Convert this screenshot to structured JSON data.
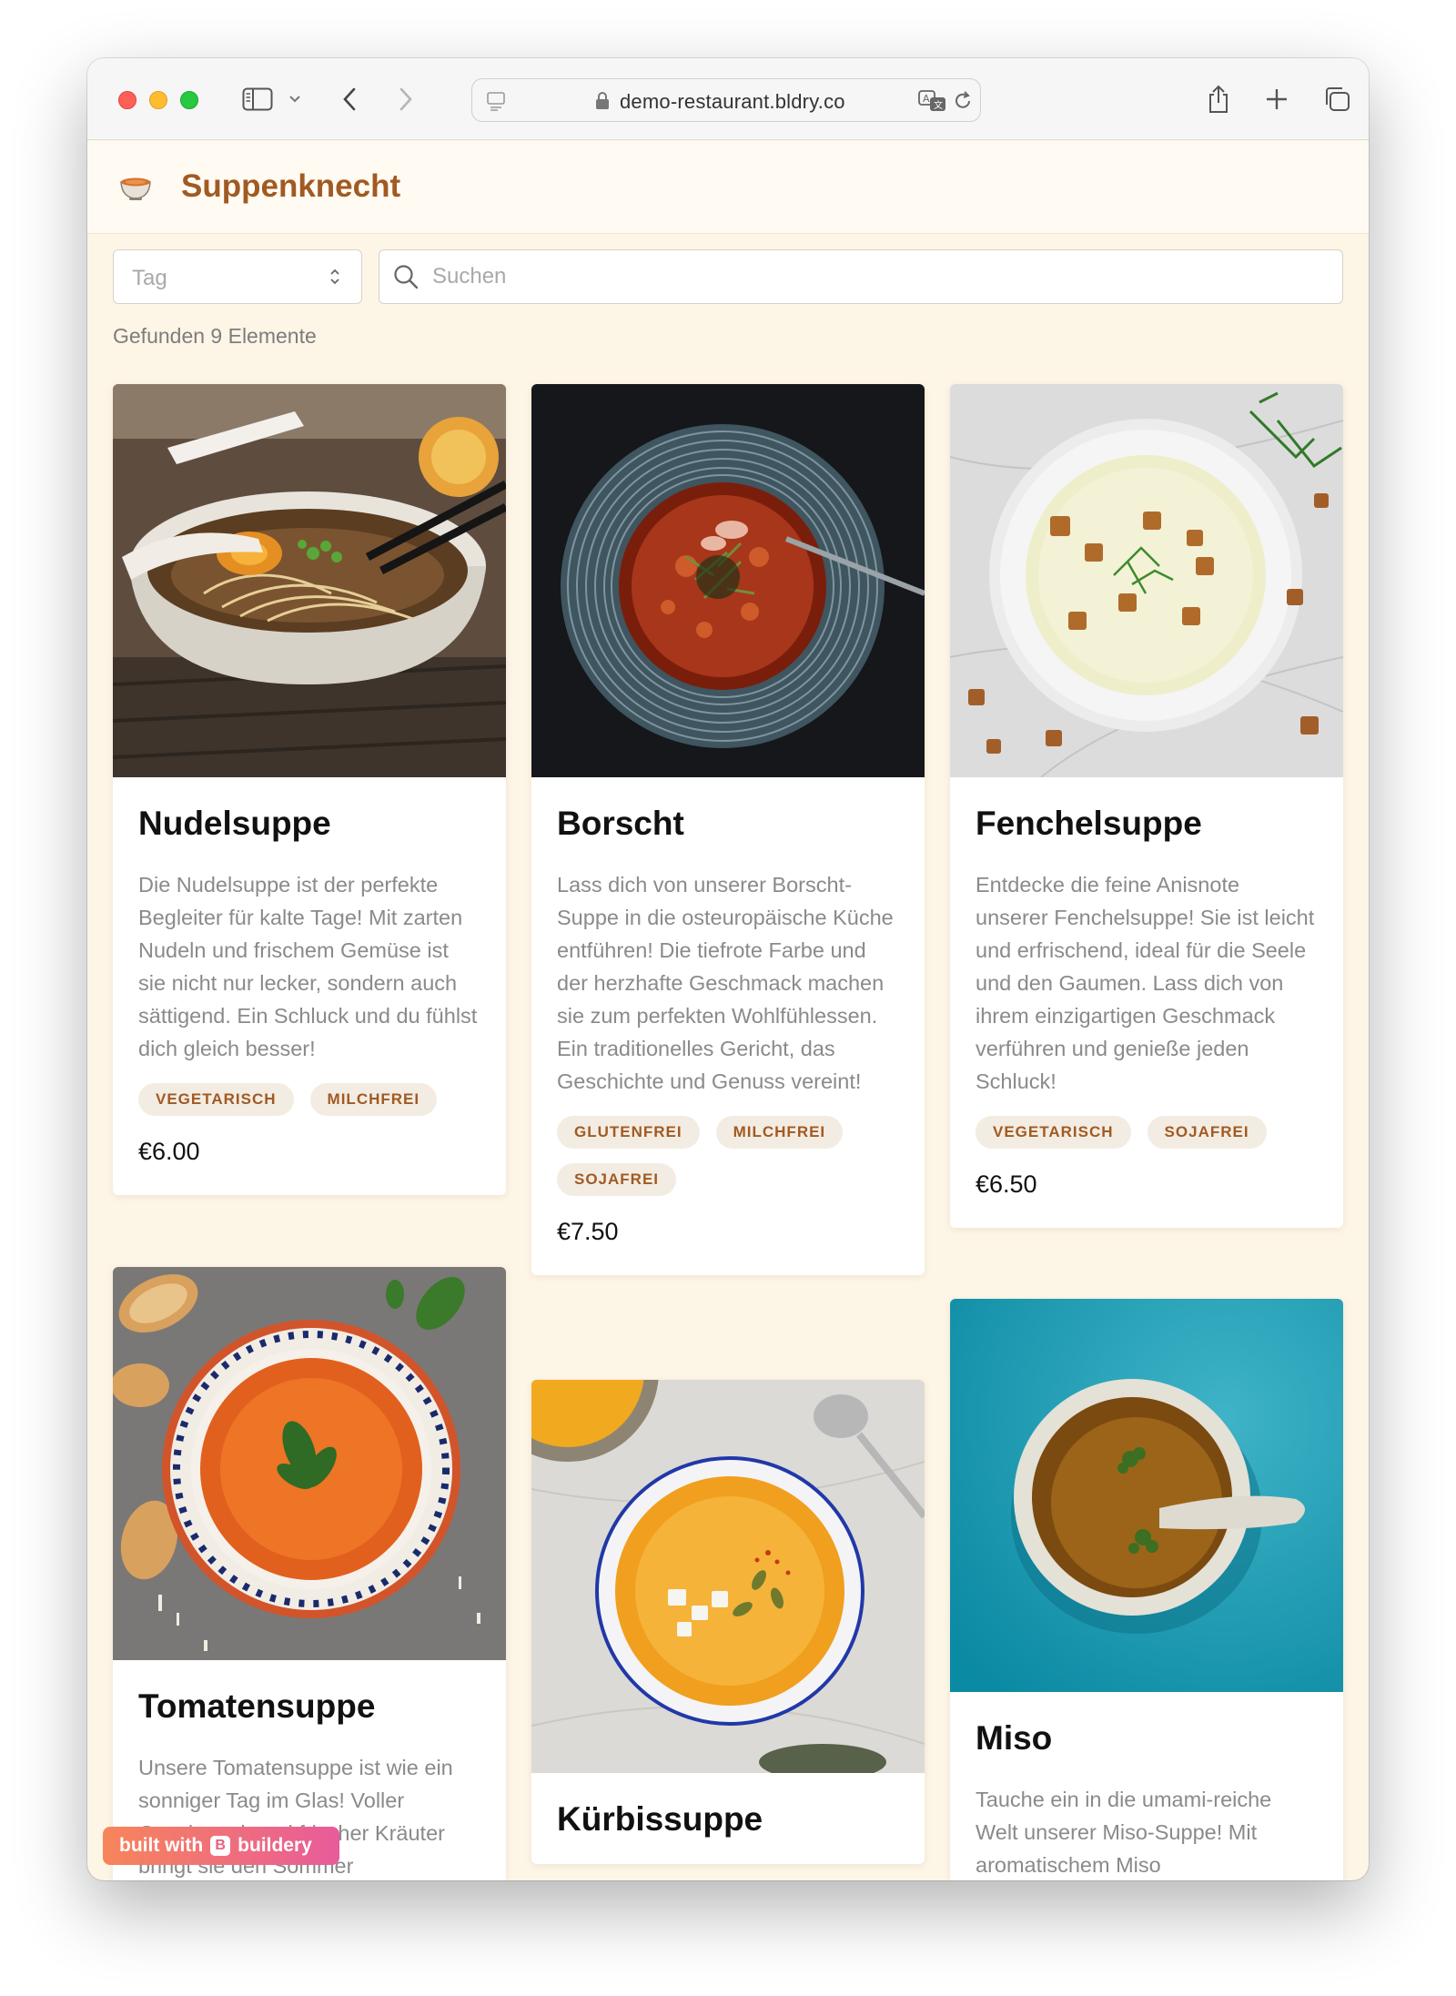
{
  "browser": {
    "url": "demo-restaurant.bldry.co"
  },
  "app": {
    "name": "Suppenknecht"
  },
  "filters": {
    "tag_placeholder": "Tag",
    "search_placeholder": "Suchen",
    "result_count_text": "Gefunden 9 Elemente"
  },
  "soups": [
    {
      "title": "Nudelsuppe",
      "description": "Die Nudelsuppe ist der perfekte Begleiter für kalte Tage! Mit zarten Nudeln und frischem Gemüse ist sie nicht nur lecker, sondern auch sättigend. Ein Schluck und du fühlst dich gleich besser!",
      "tags": [
        "VEGETARISCH",
        "MILCHFREI"
      ],
      "price": "€6.00"
    },
    {
      "title": "Borscht",
      "description": "Lass dich von unserer Borscht-Suppe in die osteuropäische Küche entführen! Die tiefrote Farbe und der herzhafte Geschmack machen sie zum perfekten Wohlfühlessen. Ein traditionelles Gericht, das Geschichte und Genuss vereint!",
      "tags": [
        "GLUTENFREI",
        "MILCHFREI",
        "SOJAFREI"
      ],
      "price": "€7.50"
    },
    {
      "title": "Fenchelsuppe",
      "description": "Entdecke die feine Anisnote unserer Fenchelsuppe! Sie ist leicht und erfrischend, ideal für die Seele und den Gaumen. Lass dich von ihrem einzigartigen Geschmack verführen und genieße jeden Schluck!",
      "tags": [
        "VEGETARISCH",
        "SOJAFREI"
      ],
      "price": "€6.50"
    },
    {
      "title": "Tomatensuppe",
      "description": "Unsere Tomatensuppe ist wie ein sonniger Tag im Glas! Voller Geschmack und frischer Kräuter bringt sie den Sommer"
    },
    {
      "title": "Kürbissuppe"
    },
    {
      "title": "Miso",
      "description": "Tauche ein in die umami-reiche Welt unserer Miso-Suppe! Mit aromatischem Miso"
    }
  ],
  "badge": {
    "prefix": "built with",
    "brand": "buildery",
    "logo_letter": "B"
  },
  "colors": {
    "brand": "#a15a22",
    "page_background": "#fdf5e6",
    "tag_background": "#f3ece3"
  }
}
